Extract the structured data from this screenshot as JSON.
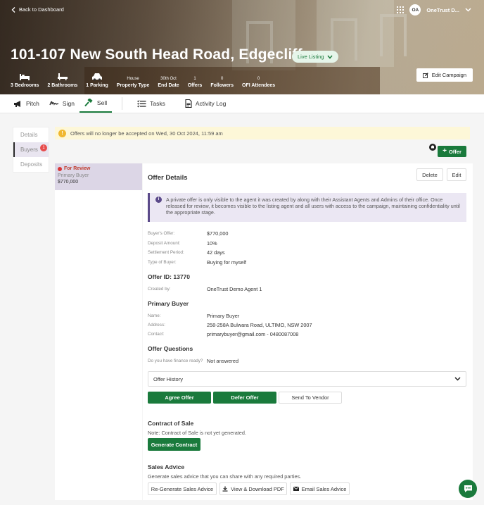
{
  "hero": {
    "back_label": "Back to Dashboard",
    "title": "101-107 New South Head Road, Edgecliff",
    "status_pill": "Live Listing",
    "user_initials": "OA",
    "user_name": "OneTrust D...",
    "edit_campaign_label": "Edit Campaign",
    "stats": [
      {
        "label": "3 Bedrooms",
        "icon": "bed-icon"
      },
      {
        "label": "2 Bathrooms",
        "icon": "bath-icon"
      },
      {
        "label": "1 Parking",
        "icon": "car-icon"
      },
      {
        "value": "House",
        "label": "Property Type"
      },
      {
        "value": "30th Oct",
        "label": "End Date"
      },
      {
        "value": "1",
        "label": "Offers"
      },
      {
        "value": "0",
        "label": "Followers"
      },
      {
        "value": "0",
        "label": "OFI Attendees"
      }
    ]
  },
  "tabs": [
    {
      "label": "Pitch",
      "icon": "megaphone-icon"
    },
    {
      "label": "Sign",
      "icon": "signature-icon"
    },
    {
      "label": "Sell",
      "icon": "gavel-icon",
      "active": true
    },
    {
      "label": "Tasks",
      "icon": "checklist-icon"
    },
    {
      "label": "Activity Log",
      "icon": "document-icon"
    }
  ],
  "subnav": [
    {
      "label": "Details"
    },
    {
      "label": "Buyers",
      "badge": "1",
      "active": true
    },
    {
      "label": "Deposits"
    }
  ],
  "alert": {
    "text": "Offers will no longer be accepted on Wed, 30 Oct 2024, 11:59 am"
  },
  "offer_button": "Offer",
  "offer_card": {
    "status": "For Review",
    "buyer": "Primary Buyer",
    "amount": "$770,000"
  },
  "details": {
    "title": "Offer Details",
    "delete_label": "Delete",
    "edit_label": "Edit",
    "info": "A private offer is only visible to the agent it was created by along with their Assistant Agents and Admins of their office. Once released for review, it becomes visible to the listing agent and all users with access to the campaign, maintaining confidentiality until the appropriate stage.",
    "rows": [
      {
        "k": "Buyer's Offer:",
        "v": "$770,000"
      },
      {
        "k": "Deposit Amount:",
        "v": "10%"
      },
      {
        "k": "Settlement Period:",
        "v": "42 days"
      },
      {
        "k": "Type of Buyer:",
        "v": "Buying for myself"
      }
    ],
    "offer_id": "Offer ID: 13770",
    "created_by_k": "Created by:",
    "created_by_v": "OneTrust Demo Agent 1",
    "primary_buyer_title": "Primary Buyer",
    "buyer_rows": [
      {
        "k": "Name:",
        "v": "Primary Buyer"
      },
      {
        "k": "Address:",
        "v": "258-258A Bulwara Road, ULTIMO, NSW 2007"
      }
    ],
    "contact_k": "Contact:",
    "contact_email": "primarybuyer@gmail.com",
    "contact_sep": " - ",
    "contact_phone": "0480087008",
    "questions_title": "Offer Questions",
    "question_k": "Do you have finance ready?",
    "question_v": "Not answered",
    "history_label": "Offer History",
    "agree_label": "Agree Offer",
    "defer_label": "Defer Offer",
    "vendor_label": "Send To Vendor",
    "contract_title": "Contract of Sale",
    "contract_note": "Note: Contract of Sale is not yet generated.",
    "generate_contract_label": "Generate Contract",
    "advice_title": "Sales Advice",
    "advice_note": "Generate sales advice that you can share with any required parties.",
    "regen_label": "Re-Generate Sales Advice",
    "download_label": "View & Download PDF",
    "email_label": "Email Sales Advice"
  },
  "colors": {
    "accent": "#1a7a3c",
    "alert_bg": "#fdf7d8",
    "info_bg": "#ebe7f3",
    "danger": "#d93636"
  }
}
